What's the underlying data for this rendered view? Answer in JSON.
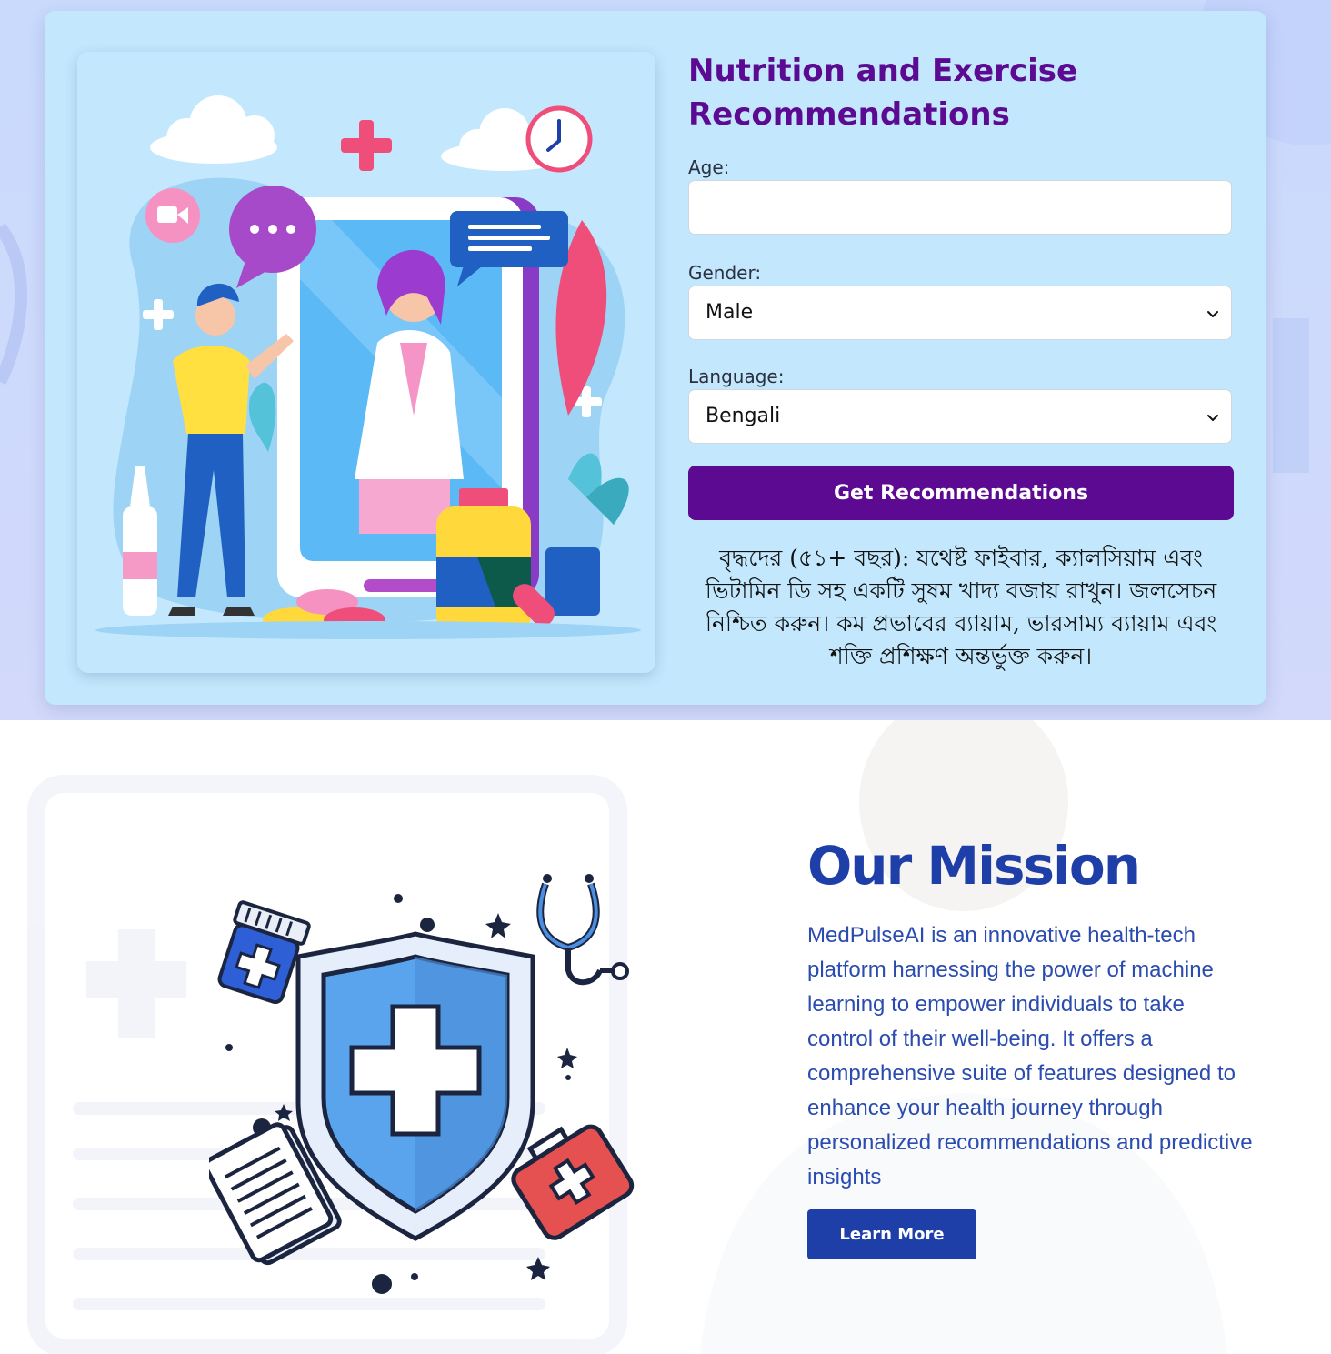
{
  "form": {
    "title": "Nutrition and Exercise Recommendations",
    "age_label": "Age:",
    "age_value": "",
    "gender_label": "Gender:",
    "gender_selected": "Male",
    "language_label": "Language:",
    "language_selected": "Bengali",
    "submit_label": "Get Recommendations",
    "result": "বৃদ্ধদের (৫১+ বছর): যথেষ্ট ফাইবার, ক্যালসিয়াম এবং ভিটামিন ডি সহ একটি সুষম খাদ্য বজায় রাখুন। জলসেচন নিশ্চিত করুন। কম প্রভাবের ব্যায়াম, ভারসাম্য ব্যায়াম এবং শক্তি প্রশিক্ষণ অন্তর্ভুক্ত করুন।"
  },
  "mission": {
    "title": "Our Mission",
    "text": "MedPulseAI is an innovative health-tech platform harnessing the power of machine learning to empower individuals to take control of their well-being. It offers a comprehensive suite of features designed to enhance your health journey through personalized recommendations and predictive insights",
    "button_label": "Learn More"
  },
  "icons": {
    "gender_select": "chevron-down-icon",
    "language_select": "chevron-down-icon",
    "telemedicine_illustration": "doctor-video-call-illustration",
    "shield_illustration": "medical-shield-illustration"
  },
  "colors": {
    "brand_purple": "#5c0a92",
    "mission_blue": "#1f3fa8",
    "card_bg": "#c3e8fd"
  }
}
